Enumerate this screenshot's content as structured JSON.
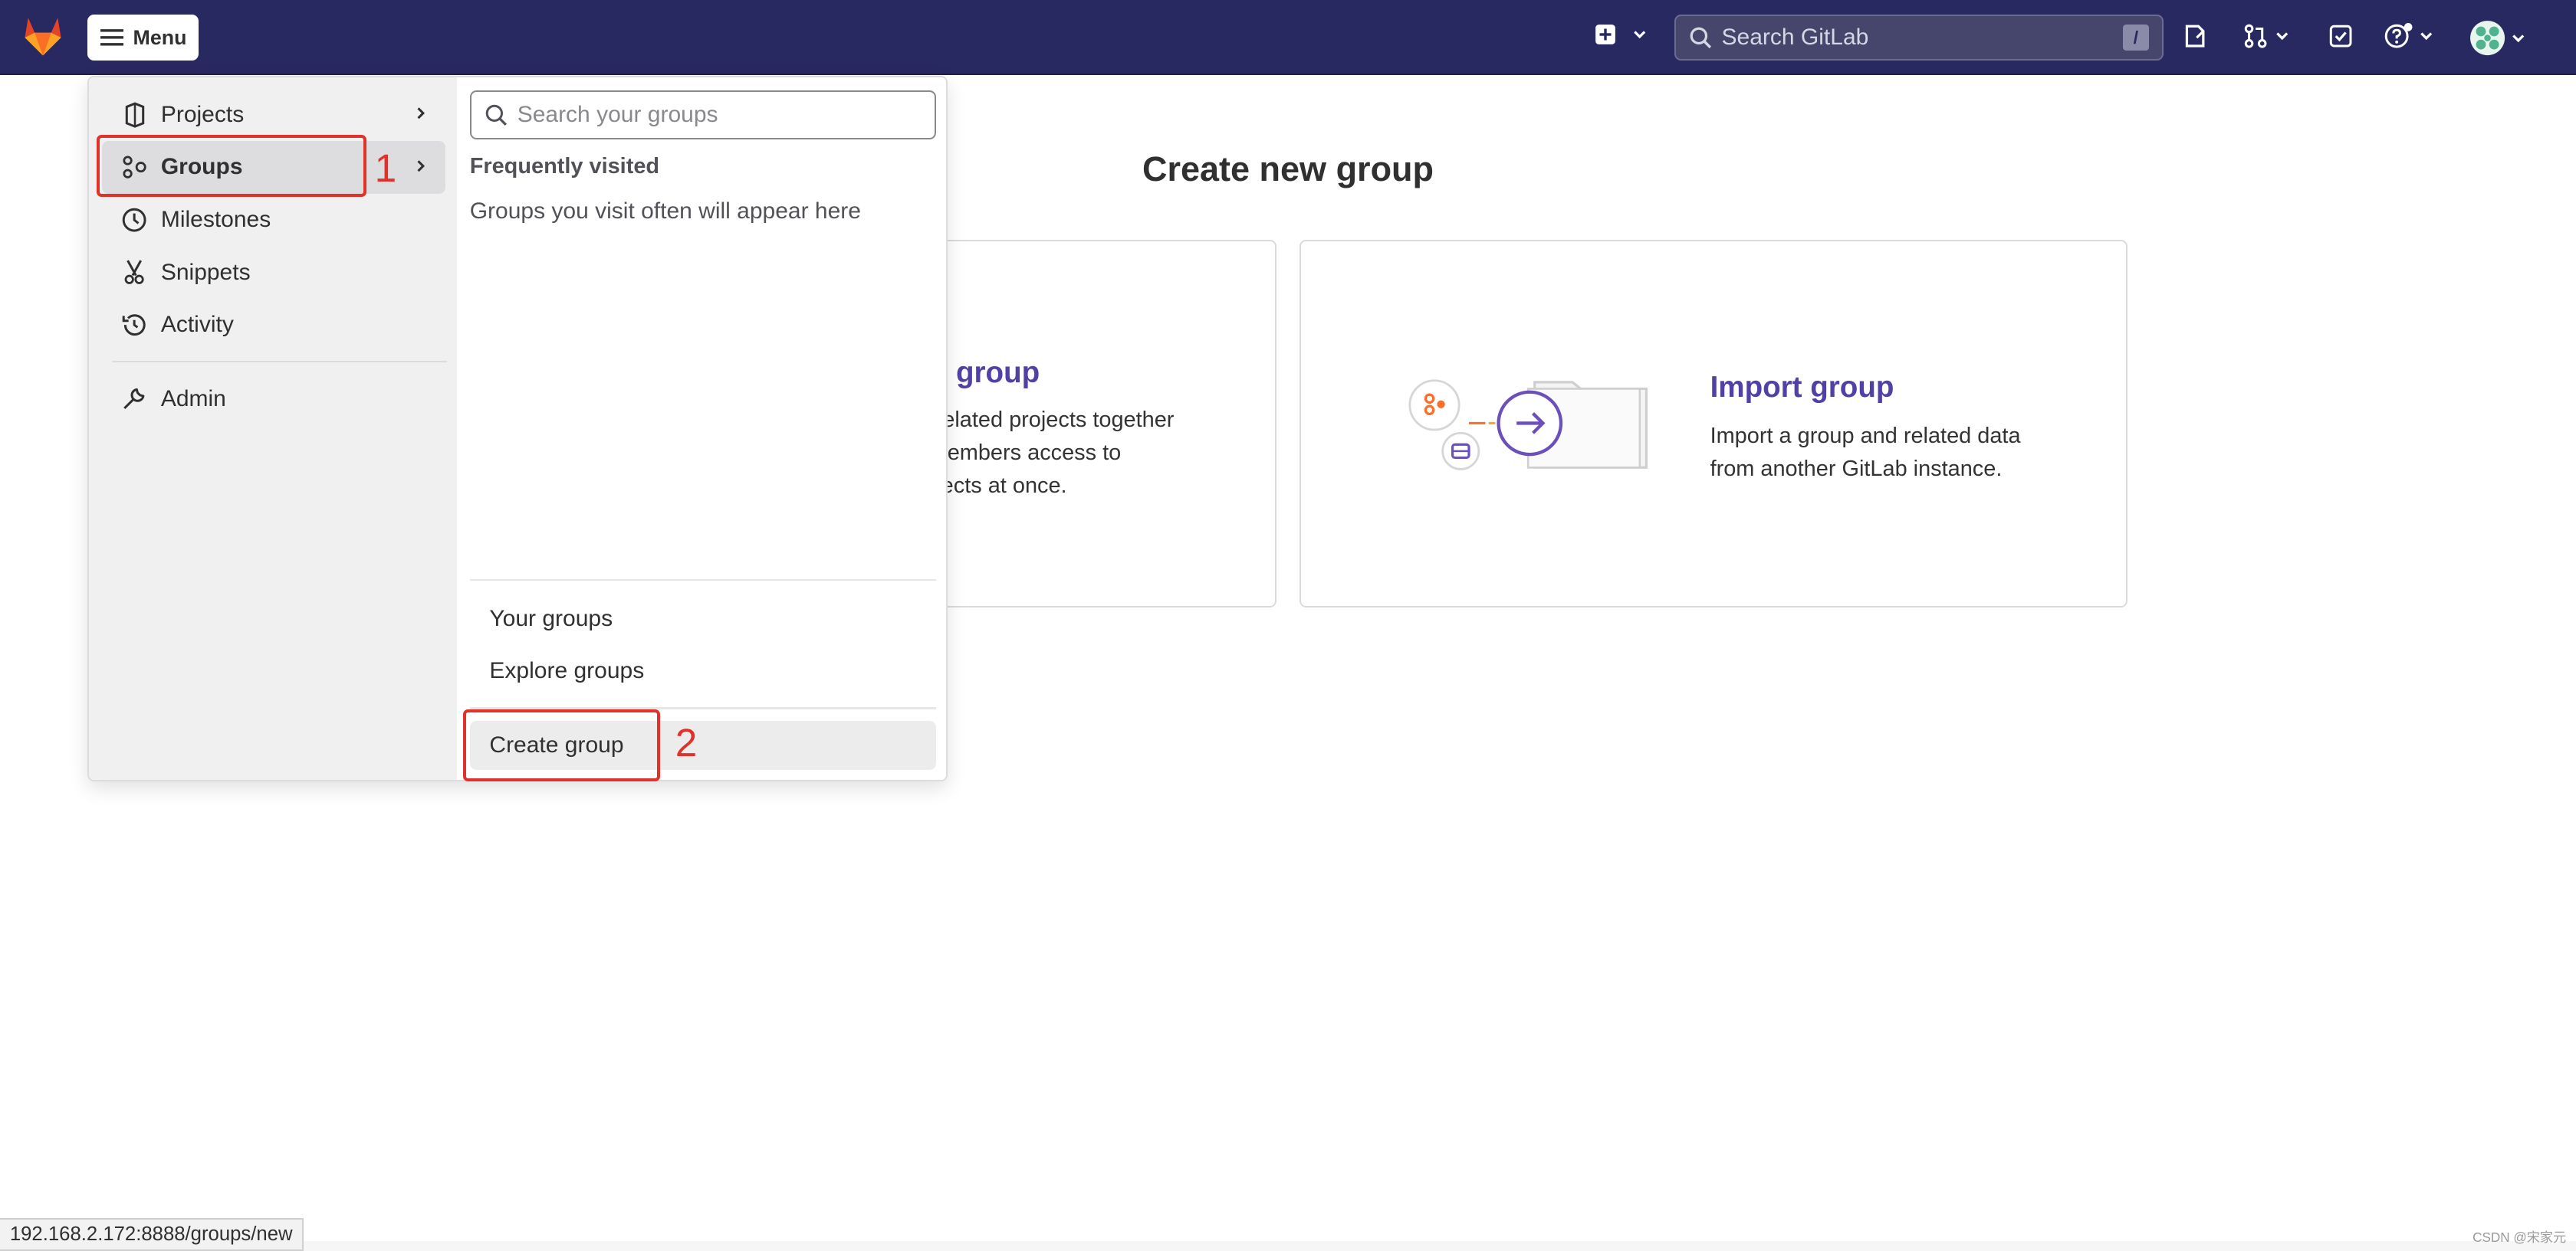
{
  "navbar": {
    "menu_label": "Menu",
    "search_placeholder": "Search GitLab",
    "search_shortcut": "/",
    "bg_color": "#292961"
  },
  "page": {
    "title": "Create new group",
    "new_group_card": {
      "title_partial": "group",
      "desc_lines": [
        "e related projects together",
        "t members access to",
        "rojects at once."
      ]
    },
    "import_card": {
      "title": "Import group",
      "desc_lines": [
        "Import a group and related data",
        "from another GitLab instance."
      ]
    }
  },
  "menu": {
    "left_items": [
      {
        "label": "Projects",
        "icon": "project-icon",
        "has_chevron": true
      },
      {
        "label": "Groups",
        "icon": "group-icon",
        "has_chevron": true,
        "active": true
      },
      {
        "label": "Milestones",
        "icon": "clock-icon"
      },
      {
        "label": "Snippets",
        "icon": "snippet-icon"
      },
      {
        "label": "Activity",
        "icon": "history-icon"
      },
      {
        "label": "Admin",
        "icon": "wrench-icon"
      }
    ],
    "groups_panel": {
      "search_placeholder": "Search your groups",
      "frequent_heading": "Frequently visited",
      "frequent_empty": "Groups you visit often will appear here",
      "links": [
        "Your groups",
        "Explore groups"
      ],
      "create_label": "Create group"
    }
  },
  "annotations": {
    "step1": "1",
    "step2": "2",
    "color": "#e0312a"
  },
  "statusbar": {
    "url": "192.168.2.172:8888/groups/new"
  },
  "watermark": "CSDN @宋家元"
}
